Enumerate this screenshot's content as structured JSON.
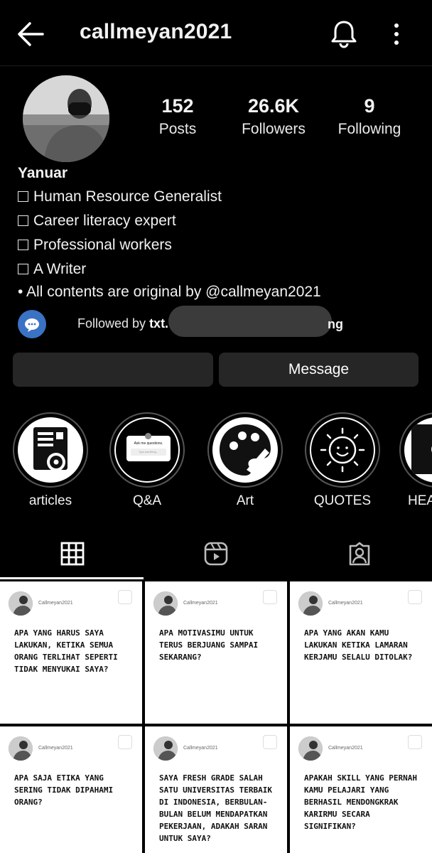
{
  "header": {
    "username": "callmeyan2021",
    "icons": [
      "arrow-back-icon",
      "bell-icon",
      "more-vertical-icon"
    ]
  },
  "profile": {
    "stats": [
      {
        "value": "152",
        "label": "Posts"
      },
      {
        "value": "26.6K",
        "label": "Followers"
      },
      {
        "value": "9",
        "label": "Following"
      }
    ],
    "name": "Yanuar",
    "bio_lines": [
      "Human Resource Generalist",
      "Career literacy expert",
      "Professional workers",
      "A Writer"
    ],
    "bio_footer": "• All contents are original by @callmeyan2021"
  },
  "followed_by": {
    "prefix": "Followed by",
    "visible_name_start": "txt.",
    "visible_name_end": "ng"
  },
  "actions": {
    "follow_label": "",
    "message_label": "Message"
  },
  "highlights": [
    {
      "label": "articles",
      "icon": "document-gear-icon"
    },
    {
      "label": "Q&A",
      "icon": "question-box-icon",
      "inner_title": "Ask me questions.",
      "inner_placeholder": "Type something..."
    },
    {
      "label": "Art",
      "icon": "palette-icon"
    },
    {
      "label": "QUOTES",
      "icon": "smiling-sun-icon"
    },
    {
      "label": "HEA",
      "icon": "partial-highlight-icon"
    }
  ],
  "tabs": [
    {
      "name": "grid",
      "icon": "grid-icon",
      "active": true
    },
    {
      "name": "reels",
      "icon": "reels-icon",
      "active": false
    },
    {
      "name": "tagged",
      "icon": "tagged-person-icon",
      "active": false
    }
  ],
  "posts": [
    {
      "handle": "Callmeyan2021",
      "text": "APA YANG HARUS SAYA LAKUKAN, KETIKA SEMUA ORANG TERLIHAT SEPERTI TIDAK MENYUKAI SAYA?"
    },
    {
      "handle": "Callmeyan2021",
      "text": "APA MOTIVASIMU UNTUK TERUS BERJUANG SAMPAI SEKARANG?"
    },
    {
      "handle": "Callmeyan2021",
      "text": "APA YANG AKAN KAMU LAKUKAN KETIKA LAMARAN KERJAMU SELALU DITOLAK?"
    },
    {
      "handle": "Callmeyan2021",
      "text": "APA SAJA ETIKA YANG SERING TIDAK DIPAHAMI ORANG?"
    },
    {
      "handle": "Callmeyan2021",
      "text": "SAYA FRESH GRADE SALAH SATU UNIVERSITAS TERBAIK DI INDONESIA, BERBULAN-BULAN BELUM MENDAPATKAN PEKERJAAN, ADAKAH SARAN UNTUK SAYA?"
    },
    {
      "handle": "Callmeyan2021",
      "text": "APAKAH SKILL YANG PERNAH KAMU PELAJARI YANG BERHASIL MENDONGKRAK KARIRMU SECARA SIGNIFIKAN?"
    }
  ]
}
